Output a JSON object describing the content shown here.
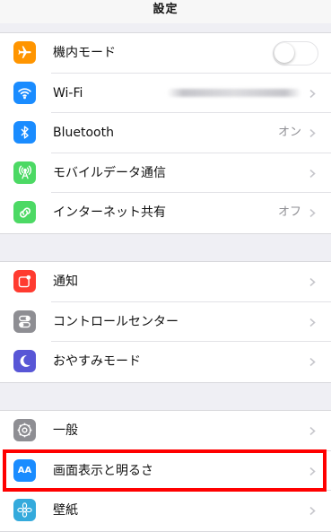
{
  "nav": {
    "title": "設定"
  },
  "group1": [
    {
      "id": "airplane",
      "label": "機内モード",
      "icon": "airplane-icon",
      "color": "#ff9500",
      "accessory": "toggle",
      "toggle_on": false
    },
    {
      "id": "wifi",
      "label": "Wi-Fi",
      "icon": "wifi-icon",
      "color": "#1a8cff",
      "accessory": "blurred-value"
    },
    {
      "id": "bluetooth",
      "label": "Bluetooth",
      "icon": "bluetooth-icon",
      "color": "#1a8cff",
      "value": "オン",
      "accessory": "chevron"
    },
    {
      "id": "cellular",
      "label": "モバイルデータ通信",
      "icon": "antenna-icon",
      "color": "#4cd964",
      "accessory": "chevron"
    },
    {
      "id": "hotspot",
      "label": "インターネット共有",
      "icon": "link-icon",
      "color": "#4cd964",
      "value": "オフ",
      "accessory": "chevron"
    }
  ],
  "group2": [
    {
      "id": "notifications",
      "label": "通知",
      "icon": "notifications-icon",
      "color": "#ff3b30"
    },
    {
      "id": "control-center",
      "label": "コントロールセンター",
      "icon": "toggles-icon",
      "color": "#8e8e93"
    },
    {
      "id": "do-not-disturb",
      "label": "おやすみモード",
      "icon": "moon-icon",
      "color": "#5856d6"
    }
  ],
  "group3": [
    {
      "id": "general",
      "label": "一般",
      "icon": "gear-icon",
      "color": "#8e8e93"
    },
    {
      "id": "display",
      "label": "画面表示と明るさ",
      "icon": "aa-icon",
      "icon_text": "AA",
      "color": "#1a8cff"
    },
    {
      "id": "wallpaper",
      "label": "壁紙",
      "icon": "flower-icon",
      "color": "#34aadc"
    }
  ],
  "colors": {
    "highlight": "#ff0000",
    "background": "#efeff4"
  }
}
